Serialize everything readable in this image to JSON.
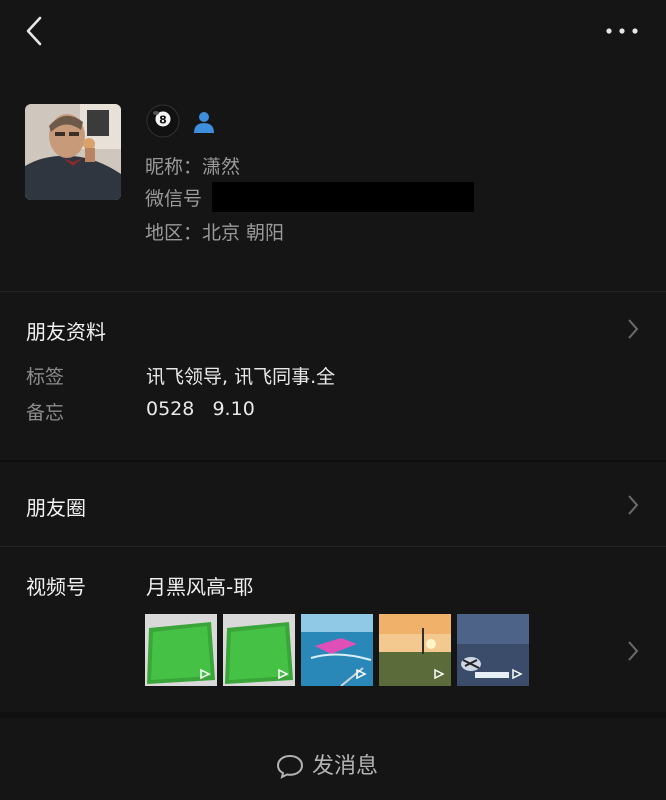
{
  "header": {
    "back_icon": "back-chevron-icon",
    "more_icon": "more-dots-icon"
  },
  "profile": {
    "avatar": "avatar",
    "badge_icons": [
      "billiard-8-ball-icon",
      "contact-person-icon"
    ],
    "nickname_line": "昵称：潇然",
    "wechat_id_label": "微信号",
    "region_line": "地区：北京 朝阳"
  },
  "friend_info": {
    "title": "朋友资料",
    "tags_label": "标签",
    "tags_value": "讯飞领导, 讯飞同事.全",
    "note_label": "备忘",
    "note_value": "0528   9.10"
  },
  "moments": {
    "title": "朋友圈"
  },
  "channels": {
    "title": "视频号",
    "account_name": "月黑风高-耶",
    "thumbnails": [
      "green-table-video",
      "green-table-video",
      "boat-video",
      "sunset-video",
      "fish-video"
    ]
  },
  "bottom": {
    "send_label": "发消息",
    "send_icon": "chat-bubble-icon"
  },
  "colors": {
    "background": "#151515",
    "primary_text": "#f2f2f2",
    "secondary_text": "#8c8c8c",
    "divider": "#222222"
  }
}
